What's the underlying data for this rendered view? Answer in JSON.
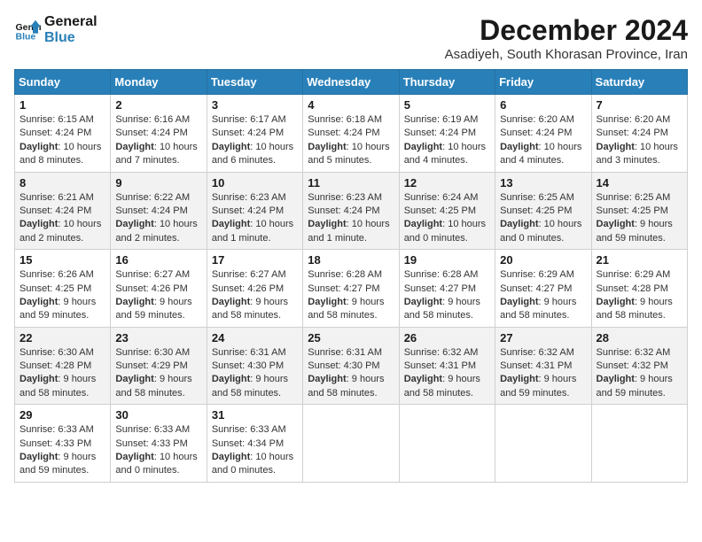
{
  "header": {
    "logo_line1": "General",
    "logo_line2": "Blue",
    "month_title": "December 2024",
    "subtitle": "Asadiyeh, South Khorasan Province, Iran"
  },
  "days_of_week": [
    "Sunday",
    "Monday",
    "Tuesday",
    "Wednesday",
    "Thursday",
    "Friday",
    "Saturday"
  ],
  "weeks": [
    [
      {
        "day": "1",
        "info": "Sunrise: 6:15 AM\nSunset: 4:24 PM\nDaylight: 10 hours and 8 minutes."
      },
      {
        "day": "2",
        "info": "Sunrise: 6:16 AM\nSunset: 4:24 PM\nDaylight: 10 hours and 7 minutes."
      },
      {
        "day": "3",
        "info": "Sunrise: 6:17 AM\nSunset: 4:24 PM\nDaylight: 10 hours and 6 minutes."
      },
      {
        "day": "4",
        "info": "Sunrise: 6:18 AM\nSunset: 4:24 PM\nDaylight: 10 hours and 5 minutes."
      },
      {
        "day": "5",
        "info": "Sunrise: 6:19 AM\nSunset: 4:24 PM\nDaylight: 10 hours and 4 minutes."
      },
      {
        "day": "6",
        "info": "Sunrise: 6:20 AM\nSunset: 4:24 PM\nDaylight: 10 hours and 4 minutes."
      },
      {
        "day": "7",
        "info": "Sunrise: 6:20 AM\nSunset: 4:24 PM\nDaylight: 10 hours and 3 minutes."
      }
    ],
    [
      {
        "day": "8",
        "info": "Sunrise: 6:21 AM\nSunset: 4:24 PM\nDaylight: 10 hours and 2 minutes."
      },
      {
        "day": "9",
        "info": "Sunrise: 6:22 AM\nSunset: 4:24 PM\nDaylight: 10 hours and 2 minutes."
      },
      {
        "day": "10",
        "info": "Sunrise: 6:23 AM\nSunset: 4:24 PM\nDaylight: 10 hours and 1 minute."
      },
      {
        "day": "11",
        "info": "Sunrise: 6:23 AM\nSunset: 4:24 PM\nDaylight: 10 hours and 1 minute."
      },
      {
        "day": "12",
        "info": "Sunrise: 6:24 AM\nSunset: 4:25 PM\nDaylight: 10 hours and 0 minutes."
      },
      {
        "day": "13",
        "info": "Sunrise: 6:25 AM\nSunset: 4:25 PM\nDaylight: 10 hours and 0 minutes."
      },
      {
        "day": "14",
        "info": "Sunrise: 6:25 AM\nSunset: 4:25 PM\nDaylight: 9 hours and 59 minutes."
      }
    ],
    [
      {
        "day": "15",
        "info": "Sunrise: 6:26 AM\nSunset: 4:25 PM\nDaylight: 9 hours and 59 minutes."
      },
      {
        "day": "16",
        "info": "Sunrise: 6:27 AM\nSunset: 4:26 PM\nDaylight: 9 hours and 59 minutes."
      },
      {
        "day": "17",
        "info": "Sunrise: 6:27 AM\nSunset: 4:26 PM\nDaylight: 9 hours and 58 minutes."
      },
      {
        "day": "18",
        "info": "Sunrise: 6:28 AM\nSunset: 4:27 PM\nDaylight: 9 hours and 58 minutes."
      },
      {
        "day": "19",
        "info": "Sunrise: 6:28 AM\nSunset: 4:27 PM\nDaylight: 9 hours and 58 minutes."
      },
      {
        "day": "20",
        "info": "Sunrise: 6:29 AM\nSunset: 4:27 PM\nDaylight: 9 hours and 58 minutes."
      },
      {
        "day": "21",
        "info": "Sunrise: 6:29 AM\nSunset: 4:28 PM\nDaylight: 9 hours and 58 minutes."
      }
    ],
    [
      {
        "day": "22",
        "info": "Sunrise: 6:30 AM\nSunset: 4:28 PM\nDaylight: 9 hours and 58 minutes."
      },
      {
        "day": "23",
        "info": "Sunrise: 6:30 AM\nSunset: 4:29 PM\nDaylight: 9 hours and 58 minutes."
      },
      {
        "day": "24",
        "info": "Sunrise: 6:31 AM\nSunset: 4:30 PM\nDaylight: 9 hours and 58 minutes."
      },
      {
        "day": "25",
        "info": "Sunrise: 6:31 AM\nSunset: 4:30 PM\nDaylight: 9 hours and 58 minutes."
      },
      {
        "day": "26",
        "info": "Sunrise: 6:32 AM\nSunset: 4:31 PM\nDaylight: 9 hours and 58 minutes."
      },
      {
        "day": "27",
        "info": "Sunrise: 6:32 AM\nSunset: 4:31 PM\nDaylight: 9 hours and 59 minutes."
      },
      {
        "day": "28",
        "info": "Sunrise: 6:32 AM\nSunset: 4:32 PM\nDaylight: 9 hours and 59 minutes."
      }
    ],
    [
      {
        "day": "29",
        "info": "Sunrise: 6:33 AM\nSunset: 4:33 PM\nDaylight: 9 hours and 59 minutes."
      },
      {
        "day": "30",
        "info": "Sunrise: 6:33 AM\nSunset: 4:33 PM\nDaylight: 10 hours and 0 minutes."
      },
      {
        "day": "31",
        "info": "Sunrise: 6:33 AM\nSunset: 4:34 PM\nDaylight: 10 hours and 0 minutes."
      },
      null,
      null,
      null,
      null
    ]
  ]
}
